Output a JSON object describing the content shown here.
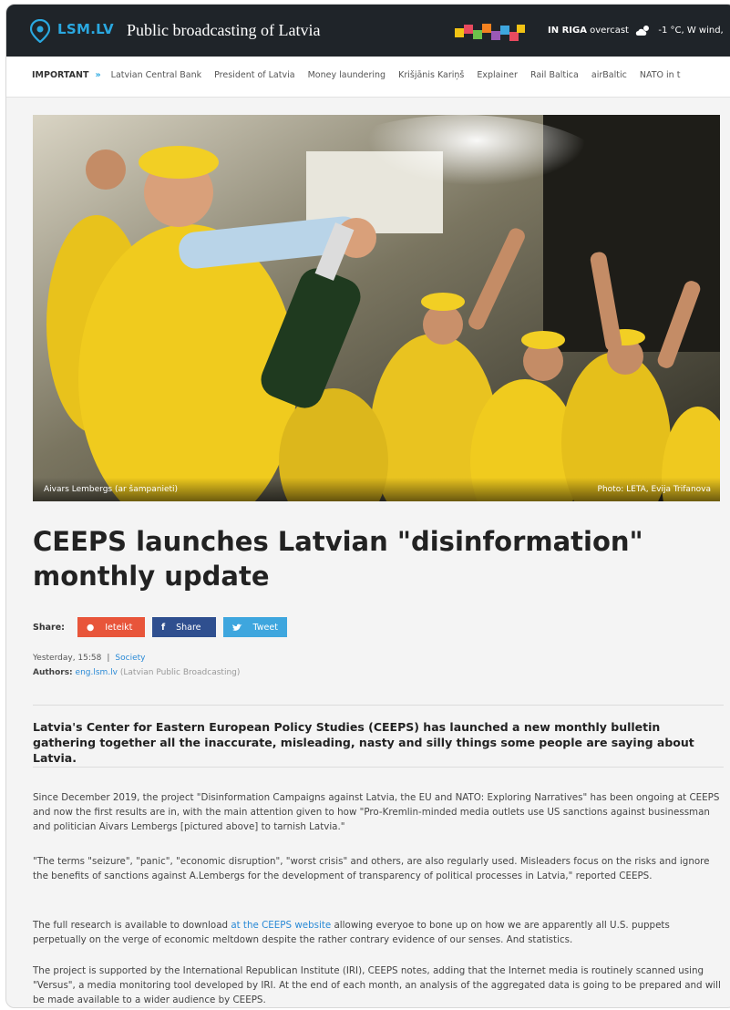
{
  "header": {
    "logo": "LSM.LV",
    "site_title": "Public broadcasting of Latvia",
    "weather_city": "IN RIGA",
    "weather_condition": "overcast",
    "weather_value": "-1 °C, W wind,"
  },
  "important": {
    "label": "IMPORTANT",
    "links": [
      "Latvian Central Bank",
      "President of Latvia",
      "Money laundering",
      "Krišjānis Kariņš",
      "Explainer",
      "Rail Baltica",
      "airBaltic",
      "NATO in t"
    ]
  },
  "photo": {
    "caption_left": "Aivars Lembergs (ar šampanieti)",
    "caption_right": "Photo: LETA, Evija Trifanova"
  },
  "article": {
    "headline": "CEEPS launches Latvian \"disinformation\" monthly update",
    "share_label": "Share:",
    "share_ieteikt": "Ieteikt",
    "share_facebook": "Share",
    "share_twitter": "Tweet",
    "date": "Yesterday, 15:58",
    "separator": "|",
    "category": "Society",
    "authors_label": "Authors:",
    "author": "eng.lsm.lv",
    "author_org": "(Latvian Public Broadcasting)",
    "lead": "Latvia's Center for Eastern European Policy Studies (CEEPS) has launched a new monthly bulletin gathering together all the inaccurate, misleading, nasty and silly things some people are saying about Latvia.",
    "p1": "Since December 2019, the project \"Disinformation Campaigns against Latvia, the EU and NATO: Exploring Narratives\" has been ongoing at CEEPS and now the first results are in, with the main attention given to how \"Pro-Kremlin-minded media outlets use US sanctions against businessman and politician Aivars Lembergs [pictured above] to tarnish Latvia.\"",
    "p2": "\"The terms \"seizure\", \"panic\", \"economic disruption\", \"worst crisis\" and others, are also regularly used. Misleaders focus on the risks and ignore the benefits of sanctions against A.Lembergs for the development of transparency of political processes in Latvia,\" reported CEEPS.",
    "p3_before": "The full research is available to download ",
    "p3_link": "at the CEEPS website",
    "p3_after": " allowing everyoe to bone up on how we are apparently all U.S. puppets perpetually on the verge of economic meltdown despite the rather contrary evidence of our senses. And statistics.",
    "p4": "The project is supported by the International Republican Institute (IRI), CEEPS notes, adding that the Internet media is routinely scanned using \"Versus\", a media monitoring tool developed by IRI. At the end of each month, an analysis of the aggregated data is going to be prepared and will be made available to a wider audience by CEEPS."
  },
  "colors": {
    "topbar": "#1f2429",
    "accent": "#2aa8e0",
    "ieteikt": "#e8553a",
    "facebook": "#2f4f8f",
    "twitter": "#3ea6de",
    "link": "#2a8ad6"
  }
}
